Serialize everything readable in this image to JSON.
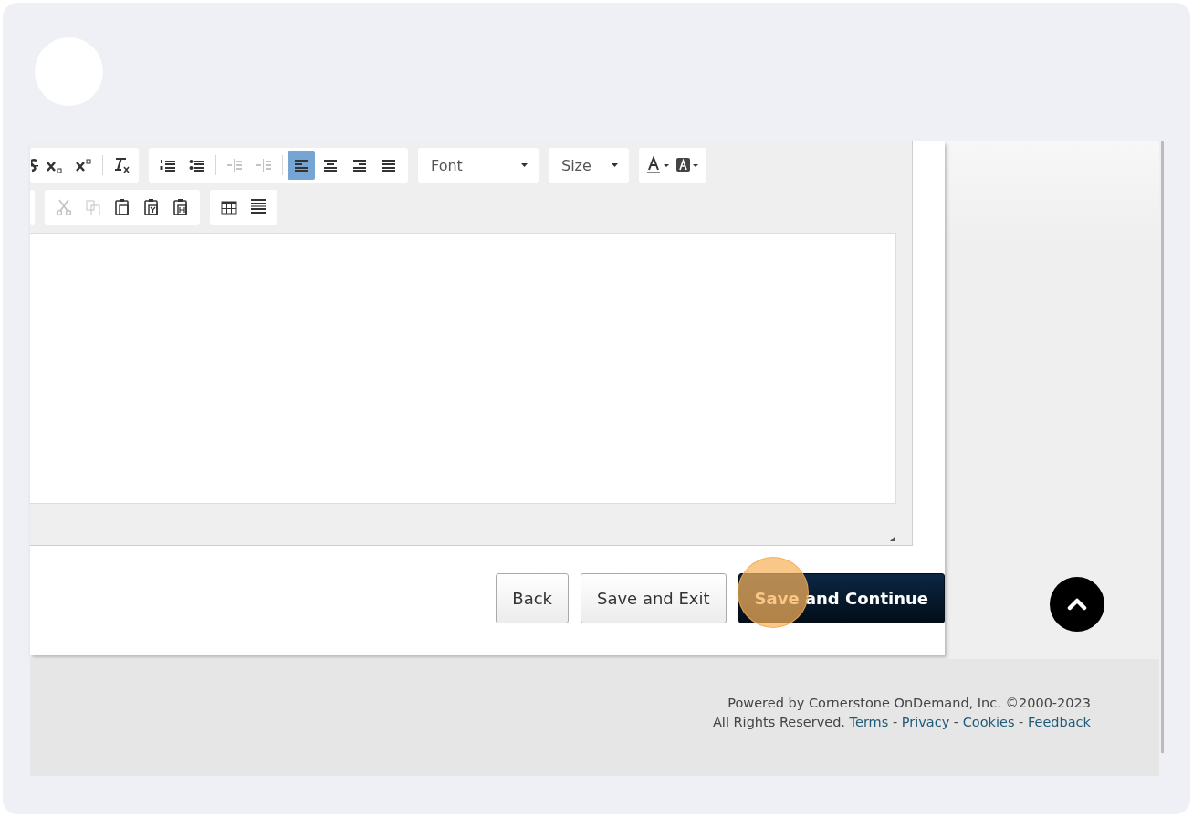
{
  "editor": {
    "toolbar_rows": [
      [
        {
          "kind": "group",
          "buttons": [
            {
              "kind": "strike",
              "disabled": false
            },
            {
              "kind": "subscript",
              "disabled": false
            },
            {
              "kind": "superscript",
              "disabled": false
            },
            {
              "kind": "separator"
            },
            {
              "kind": "clear-format",
              "disabled": false
            }
          ]
        },
        {
          "kind": "group",
          "buttons": [
            {
              "kind": "numbered-list",
              "disabled": false
            },
            {
              "kind": "bullet-list",
              "disabled": false
            },
            {
              "kind": "separator"
            },
            {
              "kind": "outdent",
              "disabled": true
            },
            {
              "kind": "indent",
              "disabled": true
            },
            {
              "kind": "separator"
            },
            {
              "kind": "align-left",
              "disabled": false,
              "selected": true
            },
            {
              "kind": "align-center",
              "disabled": false,
              "selected": false
            },
            {
              "kind": "align-right",
              "disabled": false,
              "selected": false
            },
            {
              "kind": "justify",
              "disabled": false,
              "selected": false
            }
          ]
        },
        {
          "kind": "dropdown",
          "label": "Font"
        },
        {
          "kind": "dropdown",
          "label": "Size"
        },
        {
          "kind": "group",
          "buttons": [
            {
              "kind": "text-color",
              "disabled": false
            },
            {
              "kind": "background-color",
              "disabled": false
            }
          ]
        }
      ],
      [
        {
          "kind": "group"
        },
        {
          "kind": "group",
          "buttons": [
            {
              "kind": "cut",
              "disabled": true
            },
            {
              "kind": "copy",
              "disabled": true
            },
            {
              "kind": "paste",
              "disabled": false
            },
            {
              "kind": "paste-text",
              "disabled": false
            },
            {
              "kind": "paste-word",
              "disabled": false
            }
          ]
        },
        {
          "kind": "group",
          "buttons": [
            {
              "kind": "table",
              "disabled": false
            },
            {
              "kind": "horizontal-line",
              "disabled": false
            }
          ]
        }
      ]
    ]
  },
  "actions": [
    {
      "label": "Back",
      "kind": "secondary"
    },
    {
      "label": "Save and Exit",
      "kind": "secondary"
    },
    {
      "label": "Save and Continue",
      "kind": "primary"
    }
  ],
  "footer": {
    "line_1": "Powered by Cornerstone OnDemand, Inc. ©2000-2023",
    "rights": "All Rights Reserved.",
    "links": [
      "Terms",
      "Privacy",
      "Cookies",
      "Feedback"
    ],
    "separator": "-"
  }
}
